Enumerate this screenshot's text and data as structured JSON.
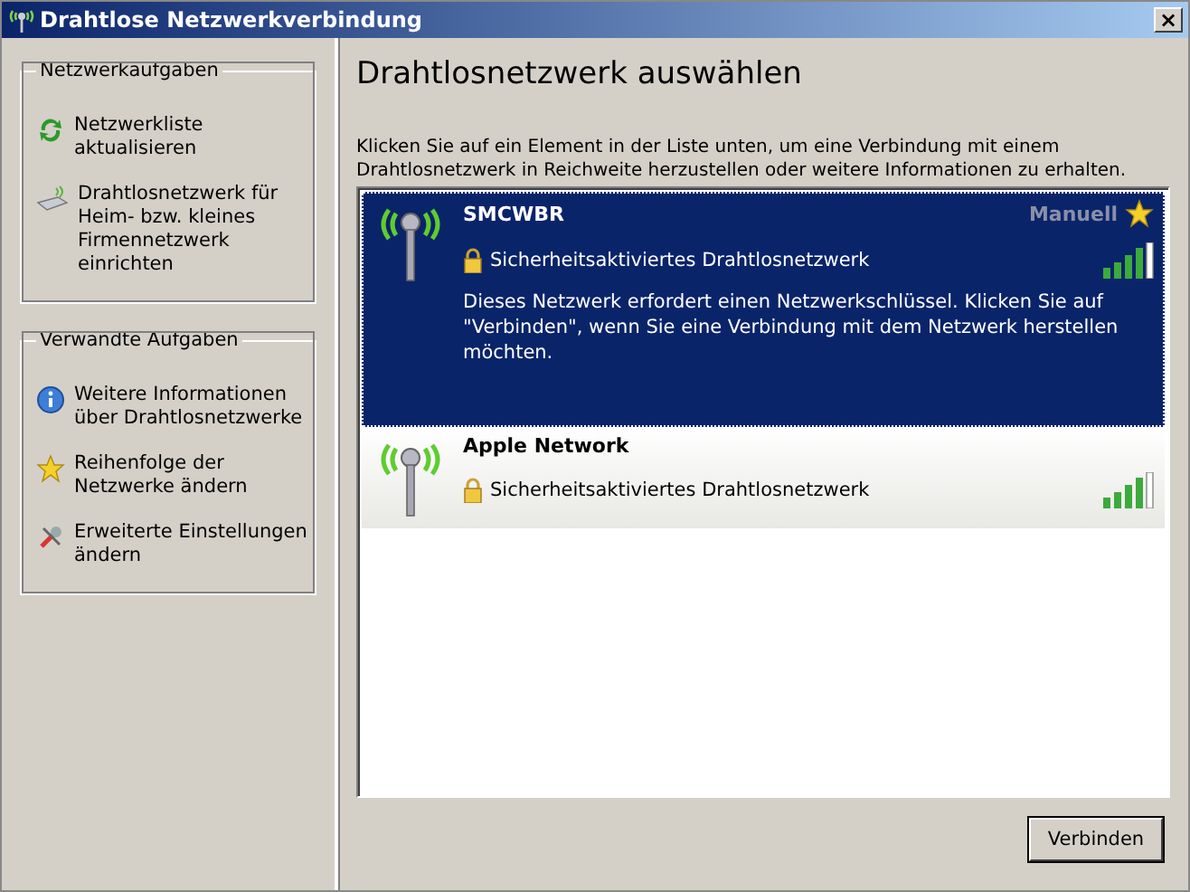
{
  "window": {
    "title": "Drahtlose Netzwerkverbindung",
    "close": "×"
  },
  "task_groups": [
    {
      "title": "Netzwerkaufgaben",
      "items": [
        {
          "kind": "refresh",
          "label": "Netzwerkliste aktualisieren"
        },
        {
          "kind": "setup",
          "label": "Drahtlosnetzwerk für Heim- bzw. kleines Firmennetzwerk einrichten"
        }
      ]
    },
    {
      "title": "Verwandte Aufgaben",
      "items": [
        {
          "kind": "info",
          "label": "Weitere Informationen über Drahtlosnetzwerke"
        },
        {
          "kind": "star",
          "label": "Reihenfolge der Netzwerke ändern"
        },
        {
          "kind": "settings",
          "label": "Erweiterte Einstellungen ändern"
        }
      ]
    }
  ],
  "heading": "Drahtlosnetzwerk auswählen",
  "instructions": "Klicken Sie auf ein Element in der Liste unten, um eine Verbindung mit einem Drahtlosnetzwerk in Reichweite herzustellen oder weitere Informationen zu erhalten.",
  "networks": [
    {
      "name": "SMCWBR",
      "selected": true,
      "tag": "Manuell",
      "security": "Sicherheitsaktiviertes Drahtlosnetzwerk",
      "description": "Dieses Netzwerk erfordert einen Netzwerkschlüssel. Klicken Sie auf \"Verbinden\", wenn Sie eine Verbindung mit dem Netzwerk herstellen möchten."
    },
    {
      "name": "Apple Network",
      "selected": false,
      "security": "Sicherheitsaktiviertes Drahtlosnetzwerk"
    }
  ],
  "buttons": [
    "Verbinden"
  ]
}
